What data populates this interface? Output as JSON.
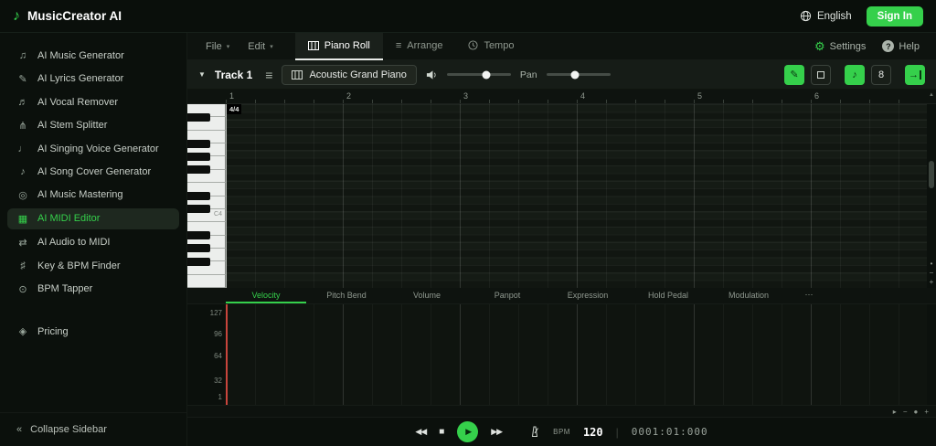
{
  "colors": {
    "accent": "#35d04b",
    "playhead_red": "#c8453c"
  },
  "header": {
    "brand": "MusicCreator AI",
    "brand_glyph": "♪",
    "language": "English",
    "sign_in": "Sign In"
  },
  "sidebar": {
    "items": [
      {
        "label": "AI Music Generator",
        "glyph": "♫"
      },
      {
        "label": "AI Lyrics Generator",
        "glyph": "✎"
      },
      {
        "label": "AI Vocal Remover",
        "glyph": "♬"
      },
      {
        "label": "AI Stem Splitter",
        "glyph": "⋔"
      },
      {
        "label": "AI Singing Voice Generator",
        "glyph": "♩"
      },
      {
        "label": "AI Song Cover Generator",
        "glyph": "♪"
      },
      {
        "label": "AI Music Mastering",
        "glyph": "◎"
      },
      {
        "label": "AI MIDI Editor",
        "glyph": "▦"
      },
      {
        "label": "AI Audio to MIDI",
        "glyph": "⇄"
      },
      {
        "label": "Key & BPM Finder",
        "glyph": "♯"
      },
      {
        "label": "BPM Tapper",
        "glyph": "⊙"
      }
    ],
    "pricing": {
      "label": "Pricing",
      "glyph": "◈"
    },
    "collapse": {
      "label": "Collapse Sidebar",
      "glyph": "«"
    }
  },
  "menubar": {
    "file": "File",
    "edit": "Edit",
    "caret": "▾",
    "tabs": [
      {
        "label": "Piano Roll"
      },
      {
        "label": "Arrange",
        "glyph": "≡"
      },
      {
        "label": "Tempo"
      }
    ],
    "settings": "Settings",
    "settings_glyph": "⚙",
    "help": "Help",
    "help_glyph": "?"
  },
  "trackbar": {
    "caret": "▼",
    "track_name": "Track 1",
    "list_glyph": "≡",
    "instrument": "Acoustic Grand Piano",
    "pan_label": "Pan",
    "pencil_glyph": "✎",
    "note_glyph": "♪",
    "arrow_glyph": "→",
    "grid_value": "8"
  },
  "ruler": {
    "time_signature": "4/4",
    "bars": [
      "1",
      "2",
      "3",
      "4",
      "5",
      "6"
    ],
    "scroll_up": "▲"
  },
  "piano_roll": {
    "c4_label": "C4",
    "zoom_dot": "•",
    "zoom_minus": "−",
    "zoom_plus": "+"
  },
  "automation": {
    "tabs": [
      "Velocity",
      "Pitch Bend",
      "Volume",
      "Panpot",
      "Expression",
      "Hold Pedal",
      "Modulation",
      "⋯"
    ],
    "active_tab": "Velocity",
    "scale": [
      "127",
      "96",
      "64",
      "32",
      "1"
    ]
  },
  "hscroll": {
    "arrow": "▸",
    "minus": "−",
    "dot": "●",
    "plus": "+"
  },
  "transport": {
    "rewind_glyph": "◀◀",
    "stop_glyph": "■",
    "play_glyph": "▶",
    "forward_glyph": "▶▶",
    "bpm_label": "BPM",
    "bpm_value": "120",
    "divider": "|",
    "time_display": "0001:01:000"
  }
}
